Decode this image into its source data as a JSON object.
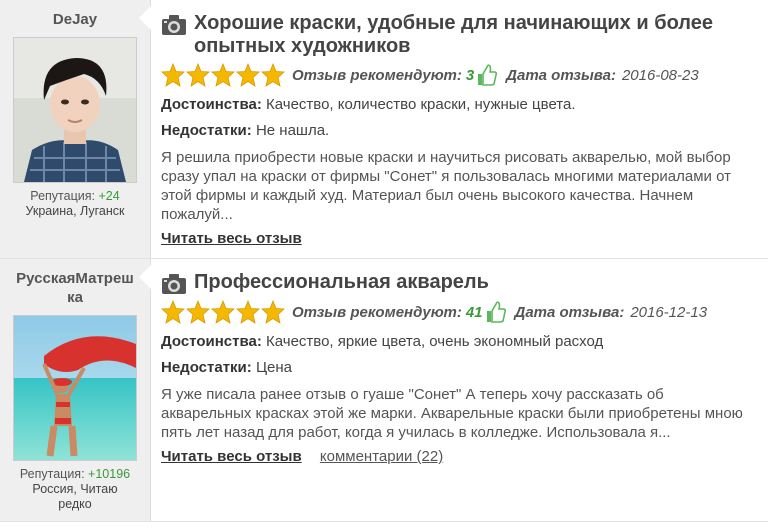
{
  "reviews": [
    {
      "username": "DeJay",
      "reputation_label": "Репутация:",
      "reputation_value": "+24",
      "location": "Украина, Луганск",
      "title": "Хорошие краски, удобные для начинающих и более опытных художников",
      "rating": 5,
      "recommend_label": "Отзыв рекомендуют:",
      "recommend_value": "3",
      "date_label": "Дата отзыва:",
      "date_value": "2016-08-23",
      "pros_label": "Достоинства:",
      "pros": "Качество, количество краски, нужные цвета.",
      "cons_label": "Недостатки:",
      "cons": "Не нашла.",
      "excerpt": "Я решила приобрести новые краски и научиться рисовать акварелью, мой выбор сразу упал на краски от фирмы \"Сонет\" я пользовалась многими материалами от этой фирмы и каждый худ. Материал был очень высокого качества. Начнем пожалуй...",
      "read_more": "Читать весь отзыв"
    },
    {
      "username": "РусскаяМатрешка",
      "reputation_label": "Репутация:",
      "reputation_value": "+10196",
      "location": "Россия, Читаю редко",
      "title": "Профессиональная акварель",
      "rating": 5,
      "recommend_label": "Отзыв рекомендуют:",
      "recommend_value": "41",
      "date_label": "Дата отзыва:",
      "date_value": "2016-12-13",
      "pros_label": "Достоинства:",
      "pros": "Качество, яркие цвета, очень экономный расход",
      "cons_label": "Недостатки:",
      "cons": "Цена",
      "excerpt": "Я уже писала ранее отзыв о гуаше \"Сонет\" А теперь хочу рассказать об акварельных красках этой же марки. Акварельные краски были приобретены мною пять лет назад для работ, когда я училась в колледже. Использовала я...",
      "read_more": "Читать весь отзыв",
      "comments": "комментарии (22)"
    }
  ],
  "colors": {
    "star": "#f5b800",
    "accent_green": "#3a9a3a",
    "sidebar_bg": "#efefef"
  },
  "icons": [
    "camera-icon",
    "star-icon",
    "thumbs-up-icon"
  ]
}
